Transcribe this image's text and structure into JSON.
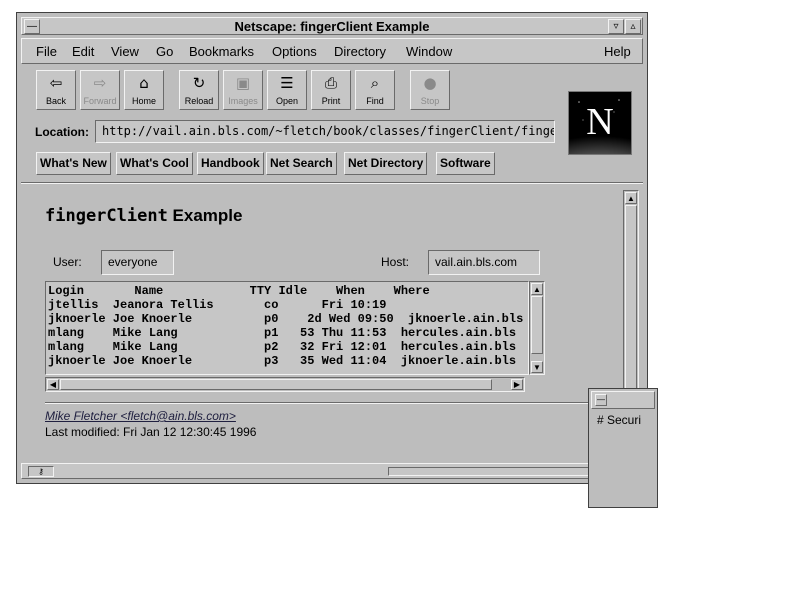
{
  "window": {
    "title": "Netscape: fingerClient Example"
  },
  "menu": [
    "File",
    "Edit",
    "View",
    "Go",
    "Bookmarks",
    "Options",
    "Directory",
    "Window"
  ],
  "menu_help": "Help",
  "toolbar": [
    {
      "label": "Back",
      "icon": "back-arrow-icon"
    },
    {
      "label": "Forward",
      "icon": "forward-arrow-icon"
    },
    {
      "label": "Home",
      "icon": "home-icon"
    },
    {
      "label": "Reload",
      "icon": "reload-icon"
    },
    {
      "label": "Images",
      "icon": "images-icon"
    },
    {
      "label": "Open",
      "icon": "open-icon"
    },
    {
      "label": "Print",
      "icon": "printer-icon"
    },
    {
      "label": "Find",
      "icon": "binoculars-icon"
    },
    {
      "label": "Stop",
      "icon": "stop-icon"
    }
  ],
  "location": {
    "label": "Location:",
    "url": "http://vail.ain.bls.com/~fletch/book/classes/fingerClient/finger"
  },
  "logo": {
    "letter": "N"
  },
  "directory_buttons": [
    "What's New",
    "What's Cool",
    "Handbook",
    "Net Search",
    "Net Directory",
    "Software"
  ],
  "page": {
    "title_mono": "fingerClient",
    "title_rest": " Example",
    "user_label": "User:",
    "user_value": "everyone",
    "host_label": "Host:",
    "host_value": "vail.ain.bls.com",
    "finger_output": "Login       Name            TTY Idle    When    Where\njtellis  Jeanora Tellis       co      Fri 10:19\njknoerle Joe Knoerle          p0    2d Wed 09:50  jknoerle.ain.bls\nmlang    Mike Lang            p1   53 Thu 11:53  hercules.ain.bls\nmlang    Mike Lang            p2   32 Fri 12:01  hercules.ain.bls\njknoerle Joe Knoerle          p3   35 Wed 11:04  jknoerle.ain.bls",
    "author": "Mike Fletcher <fletch@ain.bls.com>",
    "last_modified": "Last modified: Fri Jan 12 12:30:45 1996"
  },
  "overlay": {
    "text": "# Securi"
  },
  "colors": {
    "chrome": "#bdbdbd",
    "logo_bg": "#000000"
  }
}
